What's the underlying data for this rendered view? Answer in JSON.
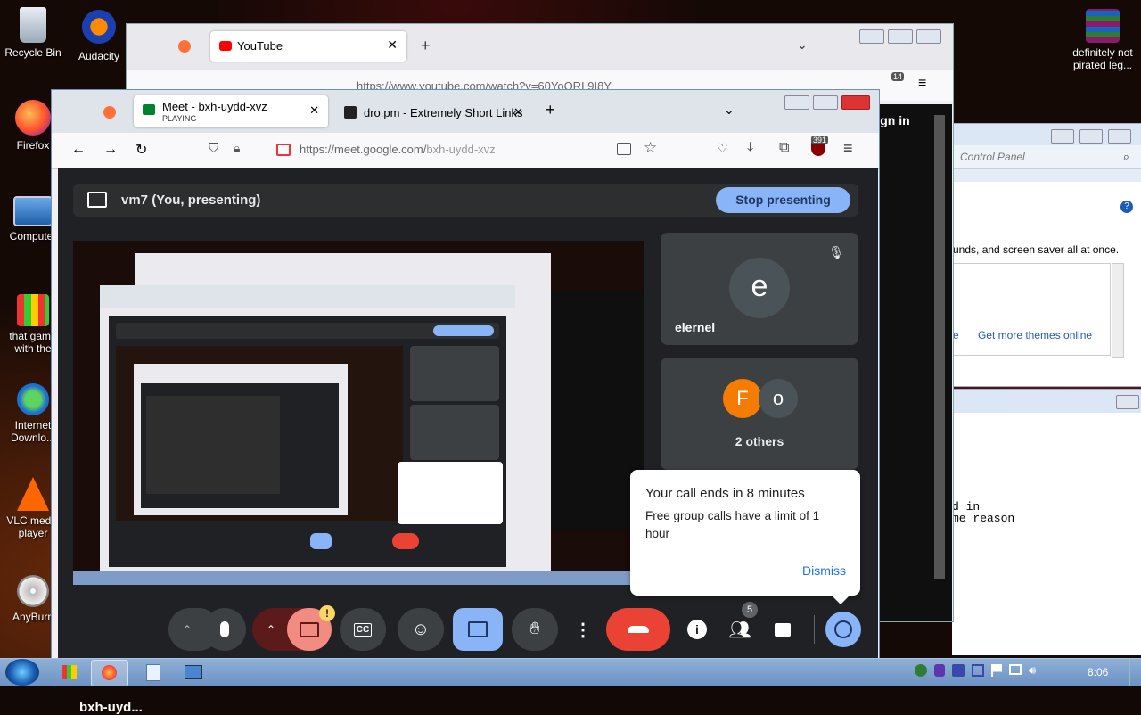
{
  "desktop": {
    "icons": [
      {
        "label": "Recycle Bin"
      },
      {
        "label": "Audacity"
      },
      {
        "label": "Firefox"
      },
      {
        "label": "Computer"
      },
      {
        "label": "that game with the"
      },
      {
        "label": "Internet Downlo..."
      },
      {
        "label": "VLC media player"
      },
      {
        "label": "AnyBurn"
      }
    ],
    "right_icon": {
      "label": "definitely not pirated leg..."
    }
  },
  "back_browser": {
    "tab_label": "YouTube",
    "url": "https://www.youtube.com/watch?v=60YoQRL9I8Y",
    "badge": "14",
    "signin": "Sign in"
  },
  "control_panel": {
    "search_placeholder": "Control Panel",
    "text1": "unds, and screen saver all at once.",
    "link1": "e",
    "link2": "Get more themes online"
  },
  "notepad": {
    "line1": "d in",
    "line2": "me reason"
  },
  "browser": {
    "tabs": [
      {
        "title": "Meet - bxh-uydd-xvz",
        "sub": "PLAYING"
      },
      {
        "title": "dro.pm - Extremely Short Links",
        "sub": ""
      }
    ],
    "url_host": "https://meet.google.com/",
    "url_path": "bxh-uydd-xvz",
    "ext_badge": "391"
  },
  "meet": {
    "presenting_label": "vm7 (You, presenting)",
    "stop_button": "Stop presenting",
    "participants": [
      {
        "initial": "e",
        "name": "elernel"
      }
    ],
    "others": {
      "initials": [
        "F",
        "o"
      ],
      "label": "2 others"
    },
    "popup": {
      "title": "Your call ends in 8 minutes",
      "body": "Free group calls have a limit of 1 hour",
      "dismiss": "Dismiss"
    },
    "meeting_code": "bxh-uyd...",
    "people_count": "5",
    "warning_badge": "!"
  },
  "taskbar": {
    "clock": "8:06"
  },
  "colors": {
    "meet_bg": "#202124",
    "meet_blue": "#8ab4f8",
    "end_red": "#ea4335",
    "tile": "#3c4043"
  }
}
